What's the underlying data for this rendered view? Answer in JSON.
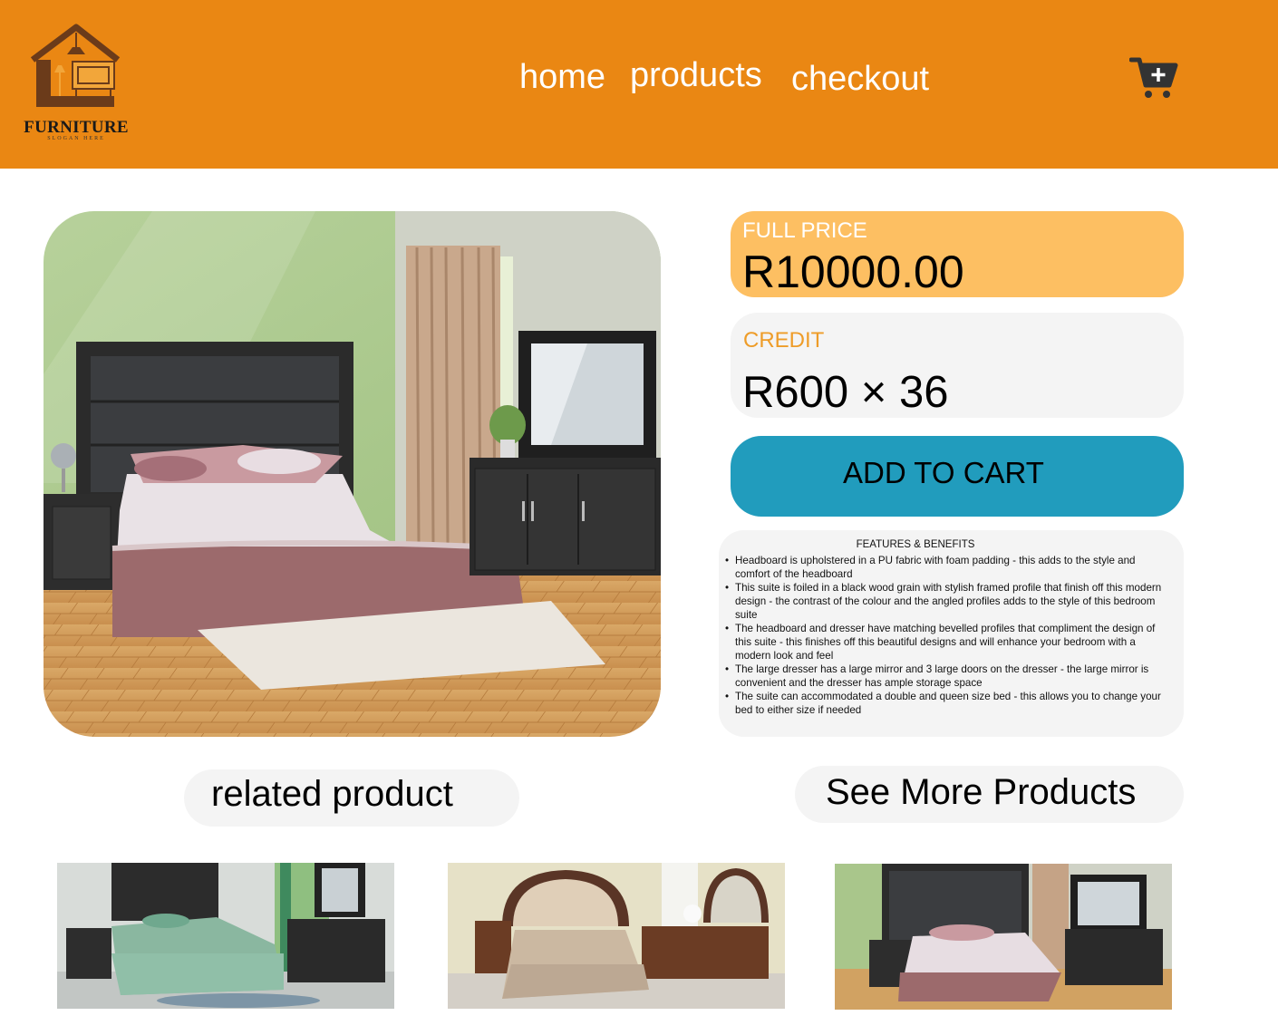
{
  "header": {
    "logo": {
      "name": "FURNITURE",
      "slogan": "SLOGAN HERE"
    },
    "nav": [
      "home",
      "products",
      "checkout"
    ],
    "cart_icon": "cart-plus-icon"
  },
  "product": {
    "image_icon": "bedroom-suite-photo",
    "full_price_label": "FULL PRICE",
    "full_price": "R10000.00",
    "credit_label": "CREDIT",
    "credit_value": "R600 × 36",
    "add_to_cart": "ADD TO CART"
  },
  "features": {
    "title": "FEATURES & BENEFITS",
    "items": [
      "Headboard is upholstered in a PU fabric with foam padding - this adds to the style and comfort of the headboard",
      "This suite is foiled in a black wood grain with stylish framed profile that finish off this modern design - the contrast of the colour and the angled profiles adds to the style of this bedroom suite",
      "The headboard and dresser have matching bevelled profiles that compliment the design of this suite - this finishes off this beautiful designs and will enhance your bedroom with a modern look and feel",
      "The large dresser has a large mirror and 3 large doors on the dresser - the large mirror is convenient and the dresser has ample storage space",
      "The suite can accommodated a double and queen size bed - this allows you to change your bed to either size if needed"
    ]
  },
  "related": {
    "label": "related product",
    "see_more": "See More Products"
  },
  "colors": {
    "header": "#ea8713",
    "price_box": "#fdbf62",
    "credit_label": "#ee9c28",
    "button": "#219cbd",
    "panel": "#f4f4f4"
  }
}
